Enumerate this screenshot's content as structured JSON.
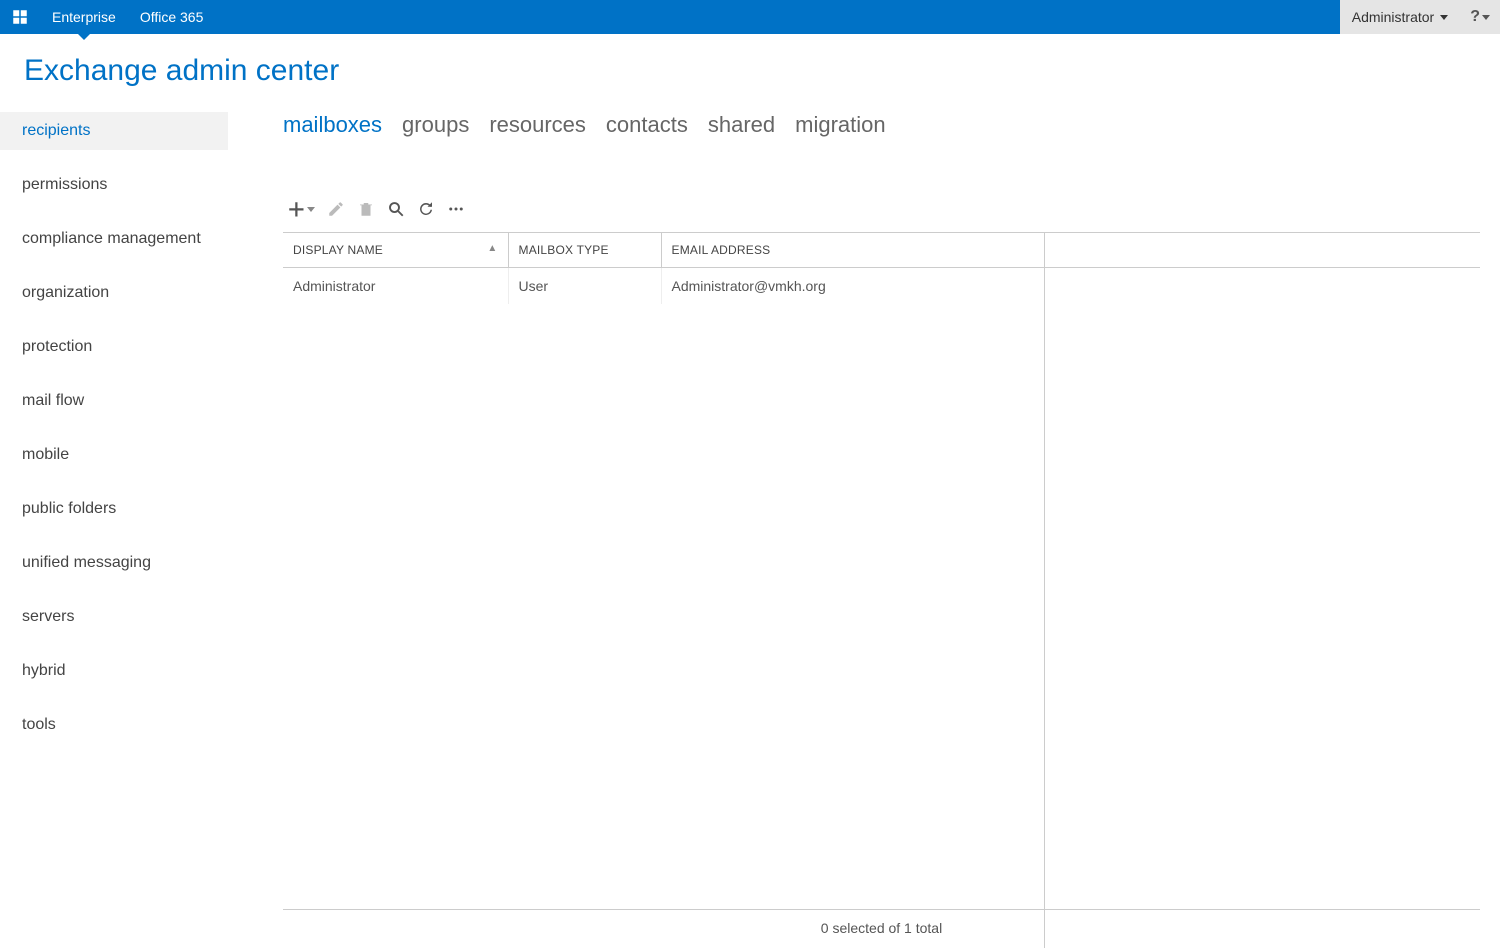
{
  "topbar": {
    "enterprise": "Enterprise",
    "office365": "Office 365",
    "user": "Administrator"
  },
  "title": "Exchange admin center",
  "sidebar": {
    "items": [
      "recipients",
      "permissions",
      "compliance management",
      "organization",
      "protection",
      "mail flow",
      "mobile",
      "public folders",
      "unified messaging",
      "servers",
      "hybrid",
      "tools"
    ]
  },
  "tabs": [
    "mailboxes",
    "groups",
    "resources",
    "contacts",
    "shared",
    "migration"
  ],
  "table": {
    "headers": [
      "DISPLAY NAME",
      "MAILBOX TYPE",
      "EMAIL ADDRESS"
    ],
    "rows": [
      {
        "display_name": "Administrator",
        "mailbox_type": "User",
        "email": "Administrator@vmkh.org"
      }
    ]
  },
  "status": "0 selected of 1 total"
}
